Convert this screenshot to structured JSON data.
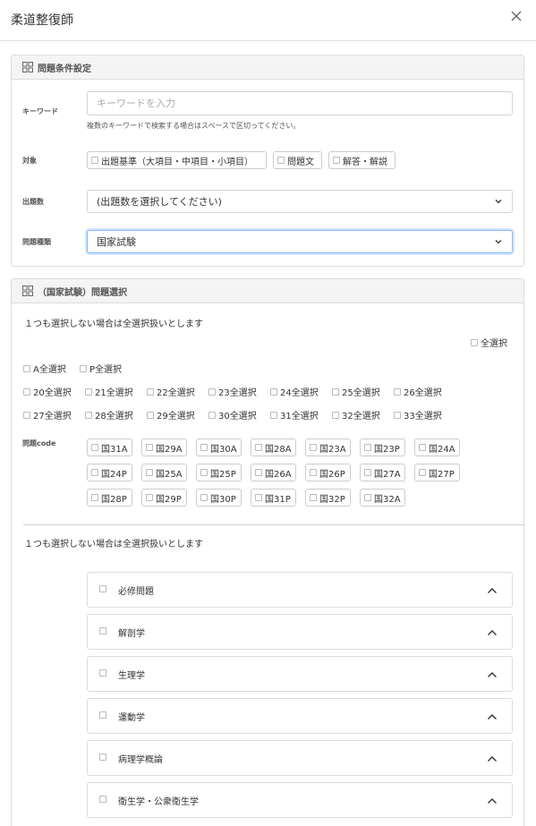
{
  "modal": {
    "title": "柔道整復師"
  },
  "conditions": {
    "header": "問題条件設定",
    "keyword": {
      "label": "キーワード",
      "placeholder": "キーワードを入力",
      "value": "",
      "hint": "複数のキーワードで検索する場合はスペースで区切ってください。"
    },
    "target": {
      "label": "対象",
      "options": [
        "出題基準（大項目・中項目・小項目）",
        "問題文",
        "解答・解説"
      ]
    },
    "count": {
      "label": "出題数",
      "selected": "(出題数を選択してください)"
    },
    "type": {
      "label": "問題種類",
      "selected": "国家試験"
    }
  },
  "selection": {
    "header": "（国家試験）問題選択",
    "note1": "１つも選択しない場合は全選択扱いとします",
    "select_all": "全選択",
    "ap_row": [
      "A全選択",
      "P全選択"
    ],
    "round_row1": [
      "20全選択",
      "21全選択",
      "22全選択",
      "23全選択",
      "24全選択",
      "25全選択",
      "26全選択"
    ],
    "round_row2": [
      "27全選択",
      "28全選択",
      "29全選択",
      "30全選択",
      "31全選択",
      "32全選択",
      "33全選択"
    ],
    "code_label": "問題code",
    "codes_row1": [
      "国31A",
      "国29A",
      "国30A",
      "国28A",
      "国23A",
      "国23P",
      "国24A"
    ],
    "codes_row2": [
      "国24P",
      "国25A",
      "国25P",
      "国26A",
      "国26P",
      "国27A",
      "国27P"
    ],
    "codes_row3": [
      "国28P",
      "国29P",
      "国30P",
      "国31P",
      "国32P",
      "国32A"
    ],
    "note2": "１つも選択しない場合は全選択扱いとします",
    "subjects": [
      "必修問題",
      "解剖学",
      "生理学",
      "運動学",
      "病理学概論",
      "衛生学・公衆衛生学"
    ]
  }
}
